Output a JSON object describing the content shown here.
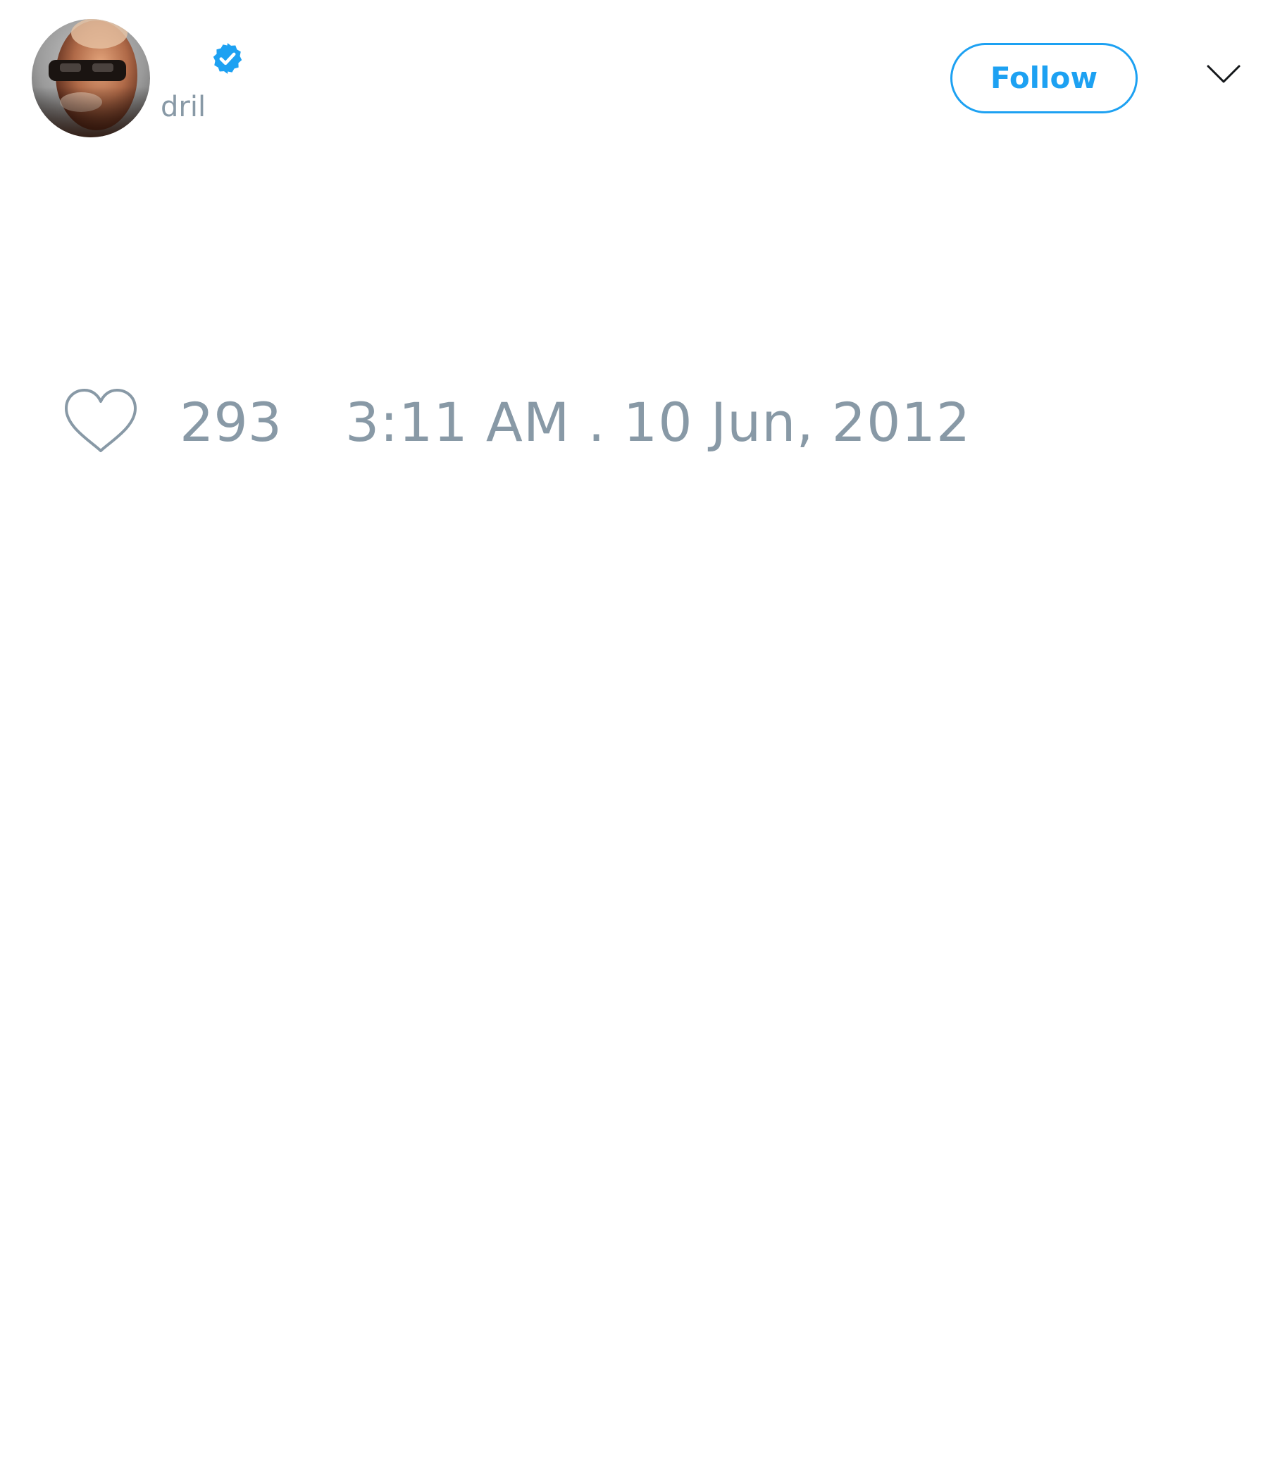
{
  "colors": {
    "accent": "#1da1f2",
    "muted": "#8899a6",
    "icon_dark": "#14171a",
    "background": "#ffffff"
  },
  "header": {
    "avatar": "profile-photo",
    "verified_icon": "verified-badge-icon",
    "handle": "dril",
    "follow_label": "Follow",
    "menu_icon": "chevron-down-icon"
  },
  "actions": {
    "like_icon": "heart-outline-icon",
    "like_count": "293",
    "timestamp": "3:11 AM . 10 Jun, 2012"
  }
}
